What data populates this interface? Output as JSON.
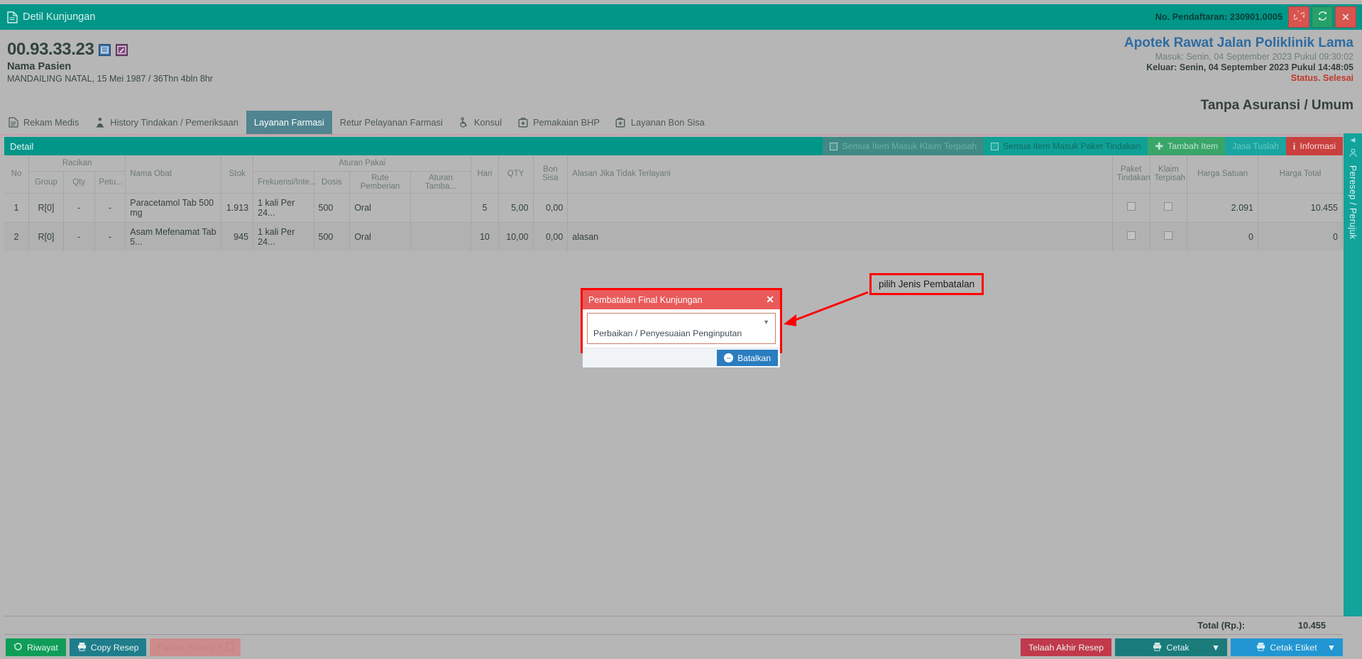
{
  "titlebar": {
    "title": "Detil Kunjungan",
    "icon": "document-icon",
    "registration_label": "No. Pendaftaran: 230901.0005",
    "buttons": [
      {
        "name": "unlink-button",
        "icon": "broken-link-icon",
        "color": "#d9534f"
      },
      {
        "name": "refresh-button",
        "icon": "refresh-icon",
        "color": "#27a06a"
      },
      {
        "name": "close-button",
        "icon": "close-icon",
        "color": "#d9534f"
      }
    ]
  },
  "patient": {
    "id": "00.93.33.23",
    "name": "Nama Pasien",
    "birth": "MANDAILING NATAL, 15 Mei 1987 / 36Thn 4bln 8hr",
    "icons": [
      "list-icon",
      "edit-icon"
    ]
  },
  "visit": {
    "unit": "Apotek Rawat Jalan Poliklinik Lama",
    "masuk": "Masuk: Senin, 04 September 2023 Pukul 09:30:02",
    "keluar": "Keluar: Senin, 04 September 2023 Pukul 14:48:05",
    "status": "Status. Selesai",
    "insurance": "Tanpa Asuransi / Umum"
  },
  "tabs": [
    {
      "label": "Rekam Medis",
      "icon": "file-icon",
      "active": false
    },
    {
      "label": "History Tindakan / Pemeriksaan",
      "icon": "microscope-icon",
      "active": false
    },
    {
      "label": "Layanan Farmasi",
      "icon": "",
      "active": true
    },
    {
      "label": "Retur Pelayanan Farmasi",
      "icon": "",
      "active": false
    },
    {
      "label": "Konsul",
      "icon": "wheelchair-icon",
      "active": false
    },
    {
      "label": "Pemakaian BHP",
      "icon": "bag-icon",
      "active": false
    },
    {
      "label": "Layanan Bon Sisa",
      "icon": "bag-icon",
      "active": false
    }
  ],
  "detail": {
    "title": "Detail",
    "toolbar": [
      {
        "name": "semua-item-masuk-klaim-terpisah",
        "label": "Semua Item Masuk Klaim Terpisah",
        "style": "disabled",
        "checkbox": true
      },
      {
        "name": "semua-item-masuk-paket-tindakan",
        "label": "Semua Item Masuk Paket Tindakan",
        "style": "chk",
        "checkbox": true
      },
      {
        "name": "tambah-item",
        "label": "Tambah Item",
        "style": "green",
        "icon": "plus-icon"
      },
      {
        "name": "jasa-tuslah",
        "label": "Jasa Tuslah",
        "style": "teal"
      },
      {
        "name": "informasi",
        "label": "Informasi",
        "style": "red",
        "icon": "info-icon"
      }
    ]
  },
  "table": {
    "group_headers": {
      "no": "No",
      "racikan": "Racikan",
      "nama_obat": "Nama Obat",
      "stok": "Stok",
      "aturan_pakai": "Aturan Pakai",
      "hari": "Hari",
      "qty": "QTY",
      "bon_sisa": "Bon Sisa",
      "alasan": "Alasan Jika Tidak Terlayani",
      "paket_tindakan": "Paket Tindakan",
      "klaim_terpisah": "Klaim Terpisah",
      "harga_satuan": "Harga Satuan",
      "harga_total": "Harga Total"
    },
    "sub_headers": {
      "group": "Group",
      "qty": "Qty",
      "petu": "Petu...",
      "frekuensi": "Frekuensi/Inte...",
      "dosis": "Dosis",
      "rute": "Rute Pemberian",
      "aturan_tambahan": "Aturan Tamba..."
    },
    "rows": [
      {
        "no": "1",
        "group": "R[0]",
        "racikan_qty": "-",
        "petu": "-",
        "nama_obat": "Paracetamol Tab 500 mg",
        "stok": "1.913",
        "frekuensi": "1 kali Per 24...",
        "dosis": "500",
        "rute": "Oral",
        "aturan_tambahan": "",
        "hari": "5",
        "qty": "5,00",
        "bon_sisa": "0,00",
        "alasan": "",
        "paket_tindakan": false,
        "klaim_terpisah": false,
        "harga_satuan": "2.091",
        "harga_total": "10.455"
      },
      {
        "no": "2",
        "group": "R[0]",
        "racikan_qty": "-",
        "petu": "-",
        "nama_obat": "Asam Mefenamat Tab 5...",
        "stok": "945",
        "frekuensi": "1 kali Per 24...",
        "dosis": "500",
        "rute": "Oral",
        "aturan_tambahan": "",
        "hari": "10",
        "qty": "10,00",
        "bon_sisa": "0,00",
        "alasan": "alasan",
        "paket_tindakan": false,
        "klaim_terpisah": false,
        "harga_satuan": "0",
        "harga_total": "0"
      }
    ],
    "total_label": "Total (Rp.):",
    "total_value": "10.455"
  },
  "footer": {
    "left": [
      {
        "name": "riwayat-button",
        "label": "Riwayat",
        "icon": "history-icon",
        "style": "green"
      },
      {
        "name": "copy-resep-button",
        "label": "Copy Resep",
        "icon": "printer-icon",
        "style": "teal"
      },
      {
        "name": "pasien-pulang-button",
        "label": "Pasien Pulang ?",
        "icon": "doc-icon",
        "style": "muted"
      }
    ],
    "right": [
      {
        "name": "telaah-akhir-resep-button",
        "label": "Telaah Akhir Resep",
        "style": "crimson"
      },
      {
        "name": "cetak-button",
        "label": "Cetak",
        "icon": "printer-icon",
        "style": "dteal",
        "caret": "▼"
      },
      {
        "name": "cetak-etiket-button",
        "label": "Cetak Etiket",
        "icon": "printer-icon",
        "style": "blue",
        "caret": "▼"
      }
    ]
  },
  "side_tab": {
    "label": "Peresep / Perujuk",
    "caret": "◀",
    "icon": "user-icon"
  },
  "modal": {
    "title": "Pembatalan Final Kunjungan",
    "close_icon": "close-icon",
    "select_value": "Perbaikan / Penyesuaian Penginputan",
    "select_caret": "▼",
    "confirm_label": "Batalkan",
    "confirm_icon": "minus-circle-icon"
  },
  "annotation": {
    "text": "pilih Jenis Pembatalan",
    "color": "#ff0000"
  }
}
